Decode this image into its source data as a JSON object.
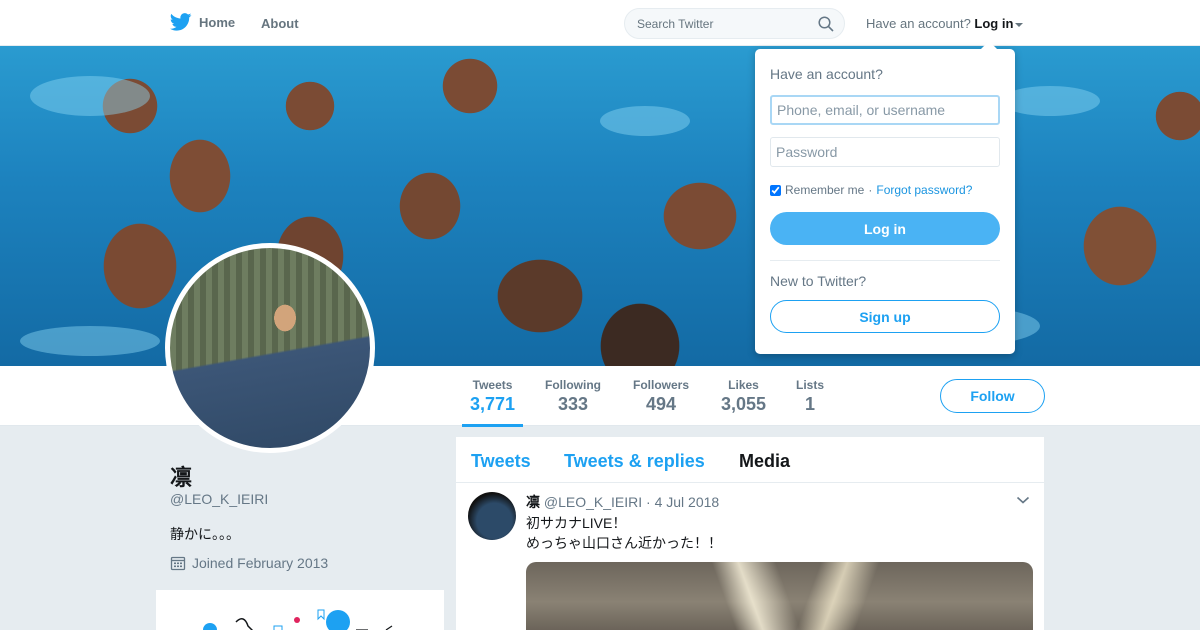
{
  "nav": {
    "home_label": "Home",
    "about_label": "About",
    "search_placeholder": "Search Twitter",
    "have_account_text": "Have an account?",
    "login_label": "Log in",
    "brand_color": "#1da1f2"
  },
  "login_dropdown": {
    "title": "Have an account?",
    "username_placeholder": "Phone, email, or username",
    "password_placeholder": "Password",
    "remember_label": "Remember me",
    "separator": "·",
    "forgot_label": "Forgot password?",
    "login_button": "Log in",
    "new_text": "New to Twitter?",
    "signup_button": "Sign up"
  },
  "profile": {
    "name": "凛",
    "handle": "@LEO_K_IEIRI",
    "bio": "静かに。。。",
    "joined": "Joined February 2013"
  },
  "stats": [
    {
      "label": "Tweets",
      "value": "3,771",
      "active": true
    },
    {
      "label": "Following",
      "value": "333"
    },
    {
      "label": "Followers",
      "value": "494"
    },
    {
      "label": "Likes",
      "value": "3,055"
    },
    {
      "label": "Lists",
      "value": "1"
    }
  ],
  "follow_button": "Follow",
  "timeline": {
    "tabs": [
      {
        "label": "Tweets"
      },
      {
        "label": "Tweets & replies"
      },
      {
        "label": "Media",
        "active": true
      }
    ],
    "tweet": {
      "name": "凛",
      "handle": "@LEO_K_IEIRI",
      "time": "· 4 Jul 2018",
      "line1": "初サカナLIVE！",
      "line2": "めっちゃ山口さん近かった！！"
    }
  }
}
